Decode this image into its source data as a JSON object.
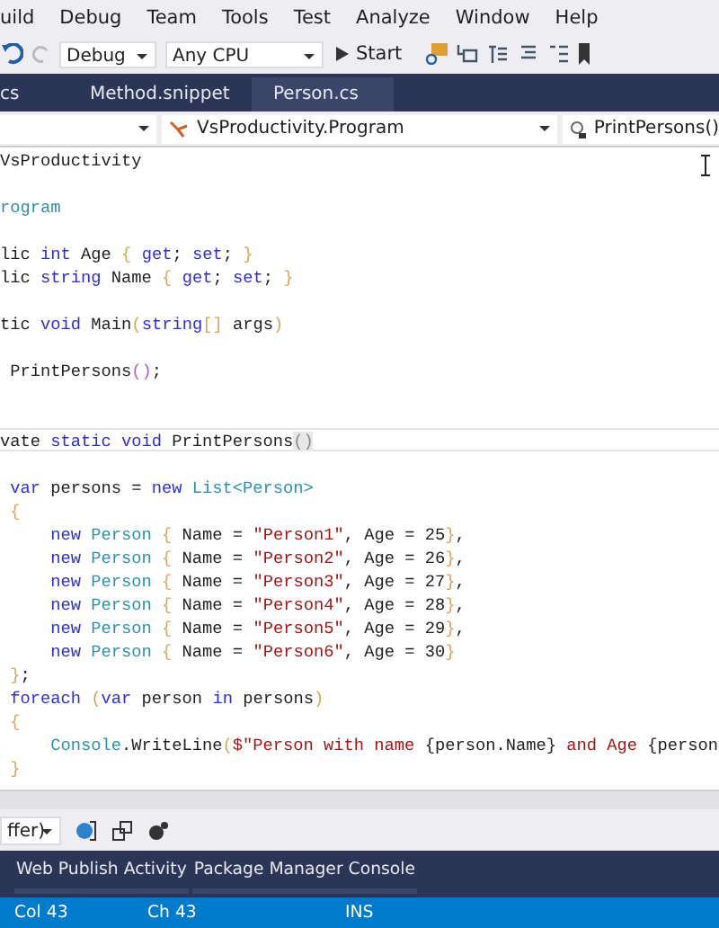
{
  "menu": [
    "uild",
    "Debug",
    "Team",
    "Tools",
    "Test",
    "Analyze",
    "Window",
    "Help"
  ],
  "toolbar": {
    "configuration": "Debug",
    "platform": "Any CPU",
    "start": "Start"
  },
  "tabs": [
    {
      "label": "cs",
      "selected": false
    },
    {
      "label": "Method.snippet",
      "selected": false
    },
    {
      "label": "Person.cs",
      "selected": false
    }
  ],
  "nav": {
    "type": "VsProductivity.Program",
    "member": "PrintPersons()"
  },
  "code": [
    {
      "current": false,
      "tokens": [
        {
          "kind": "plain",
          "text": "VsProductivity"
        }
      ]
    },
    {
      "current": false
    },
    {
      "current": false,
      "tokens": [
        {
          "kind": "type",
          "text": "rogram"
        }
      ]
    },
    {
      "current": false
    },
    {
      "current": false,
      "tokens": [
        {
          "kind": "plain",
          "text": "lic "
        },
        {
          "kind": "keyword",
          "text": "int"
        },
        {
          "kind": "plain",
          "text": " Age "
        },
        {
          "kind": "brace",
          "text": "{"
        },
        {
          "kind": "keyword",
          "text": " get"
        },
        {
          "kind": "plain",
          "text": ";"
        },
        {
          "kind": "keyword",
          "text": " set"
        },
        {
          "kind": "plain",
          "text": "; "
        },
        {
          "kind": "brace",
          "text": "}"
        }
      ]
    },
    {
      "current": false,
      "tokens": [
        {
          "kind": "plain",
          "text": "lic "
        },
        {
          "kind": "keyword",
          "text": "string"
        },
        {
          "kind": "plain",
          "text": " Name "
        },
        {
          "kind": "brace",
          "text": "{"
        },
        {
          "kind": "keyword",
          "text": " get"
        },
        {
          "kind": "plain",
          "text": ";"
        },
        {
          "kind": "keyword",
          "text": " set"
        },
        {
          "kind": "plain",
          "text": "; "
        },
        {
          "kind": "brace",
          "text": "}"
        }
      ]
    },
    {
      "current": false
    },
    {
      "current": false,
      "tokens": [
        {
          "kind": "plain",
          "text": "tic "
        },
        {
          "kind": "keyword",
          "text": "void"
        },
        {
          "kind": "plain",
          "text": " Main"
        },
        {
          "kind": "brace",
          "text": "("
        },
        {
          "kind": "keyword",
          "text": "string"
        },
        {
          "kind": "brace",
          "text": "[]"
        },
        {
          "kind": "plain",
          "text": " args"
        },
        {
          "kind": "brace",
          "text": ")"
        }
      ]
    },
    {
      "current": false
    },
    {
      "current": false,
      "tokens": [
        {
          "kind": "plain",
          "text": " PrintPersons"
        },
        {
          "kind": "paren",
          "text": "()"
        },
        {
          "kind": "plain",
          "text": ";"
        }
      ]
    },
    {
      "current": false
    },
    {
      "current": false
    },
    {
      "current": true,
      "tokens": [
        {
          "kind": "plain",
          "text": "vate "
        },
        {
          "kind": "keyword",
          "text": "static void"
        },
        {
          "kind": "plain",
          "text": " PrintPersons"
        },
        {
          "kind": "match",
          "text": "()"
        }
      ]
    },
    {
      "current": false
    },
    {
      "current": false,
      "tokens": [
        {
          "kind": "keyword",
          "text": " var"
        },
        {
          "kind": "plain",
          "text": " persons = "
        },
        {
          "kind": "keyword",
          "text": "new"
        },
        {
          "kind": "type",
          "text": " List<Person>"
        }
      ]
    },
    {
      "current": false,
      "tokens": [
        {
          "kind": "brace",
          "text": " {"
        }
      ]
    },
    {
      "current": false,
      "tokens": [
        {
          "kind": "keyword",
          "text": "     new"
        },
        {
          "kind": "type",
          "text": " Person "
        },
        {
          "kind": "brace",
          "text": "{"
        },
        {
          "kind": "plain",
          "text": " Name = "
        },
        {
          "kind": "string",
          "text": "\"Person1\""
        },
        {
          "kind": "plain",
          "text": ", Age = 25"
        },
        {
          "kind": "brace",
          "text": "}"
        },
        {
          "kind": "plain",
          "text": ","
        }
      ]
    },
    {
      "current": false,
      "tokens": [
        {
          "kind": "keyword",
          "text": "     new"
        },
        {
          "kind": "type",
          "text": " Person "
        },
        {
          "kind": "brace",
          "text": "{"
        },
        {
          "kind": "plain",
          "text": " Name = "
        },
        {
          "kind": "string",
          "text": "\"Person2\""
        },
        {
          "kind": "plain",
          "text": ", Age = 26"
        },
        {
          "kind": "brace",
          "text": "}"
        },
        {
          "kind": "plain",
          "text": ","
        }
      ]
    },
    {
      "current": false,
      "tokens": [
        {
          "kind": "keyword",
          "text": "     new"
        },
        {
          "kind": "type",
          "text": " Person "
        },
        {
          "kind": "brace",
          "text": "{"
        },
        {
          "kind": "plain",
          "text": " Name = "
        },
        {
          "kind": "string",
          "text": "\"Person3\""
        },
        {
          "kind": "plain",
          "text": ", Age = 27"
        },
        {
          "kind": "brace",
          "text": "}"
        },
        {
          "kind": "plain",
          "text": ","
        }
      ]
    },
    {
      "current": false,
      "tokens": [
        {
          "kind": "keyword",
          "text": "     new"
        },
        {
          "kind": "type",
          "text": " Person "
        },
        {
          "kind": "brace",
          "text": "{"
        },
        {
          "kind": "plain",
          "text": " Name = "
        },
        {
          "kind": "string",
          "text": "\"Person4\""
        },
        {
          "kind": "plain",
          "text": ", Age = 28"
        },
        {
          "kind": "brace",
          "text": "}"
        },
        {
          "kind": "plain",
          "text": ","
        }
      ]
    },
    {
      "current": false,
      "tokens": [
        {
          "kind": "keyword",
          "text": "     new"
        },
        {
          "kind": "type",
          "text": " Person "
        },
        {
          "kind": "brace",
          "text": "{"
        },
        {
          "kind": "plain",
          "text": " Name = "
        },
        {
          "kind": "string",
          "text": "\"Person5\""
        },
        {
          "kind": "plain",
          "text": ", Age = 29"
        },
        {
          "kind": "brace",
          "text": "}"
        },
        {
          "kind": "plain",
          "text": ","
        }
      ]
    },
    {
      "current": false,
      "tokens": [
        {
          "kind": "keyword",
          "text": "     new"
        },
        {
          "kind": "type",
          "text": " Person "
        },
        {
          "kind": "brace",
          "text": "{"
        },
        {
          "kind": "plain",
          "text": " Name = "
        },
        {
          "kind": "string",
          "text": "\"Person6\""
        },
        {
          "kind": "plain",
          "text": ", Age = 30"
        },
        {
          "kind": "brace",
          "text": "}"
        }
      ]
    },
    {
      "current": false,
      "tokens": [
        {
          "kind": "brace",
          "text": " }"
        },
        {
          "kind": "plain",
          "text": ";"
        }
      ]
    },
    {
      "current": false,
      "tokens": [
        {
          "kind": "keyword",
          "text": " foreach"
        },
        {
          "kind": "brace",
          "text": " ("
        },
        {
          "kind": "keyword",
          "text": "var"
        },
        {
          "kind": "plain",
          "text": " person "
        },
        {
          "kind": "keyword",
          "text": "in"
        },
        {
          "kind": "plain",
          "text": " persons"
        },
        {
          "kind": "brace",
          "text": ")"
        }
      ]
    },
    {
      "current": false,
      "tokens": [
        {
          "kind": "brace",
          "text": " {"
        }
      ]
    },
    {
      "current": false,
      "tokens": [
        {
          "kind": "type",
          "text": "     Console"
        },
        {
          "kind": "plain",
          "text": ".WriteLine"
        },
        {
          "kind": "brace",
          "text": "("
        },
        {
          "kind": "string",
          "text": "$\"Person with name "
        },
        {
          "kind": "plain",
          "text": "{person.Name}"
        },
        {
          "kind": "string",
          "text": " and Age "
        },
        {
          "kind": "plain",
          "text": "{person"
        }
      ]
    },
    {
      "current": false,
      "tokens": [
        {
          "kind": "brace",
          "text": " }"
        }
      ]
    }
  ],
  "output": {
    "source": "ffer)"
  },
  "bottom_tabs": [
    {
      "label": "Web Publish Activity",
      "selected": false
    },
    {
      "label": "Package Manager Console",
      "selected": false
    }
  ],
  "status": [
    "Col 43",
    "Ch 43",
    "INS"
  ]
}
